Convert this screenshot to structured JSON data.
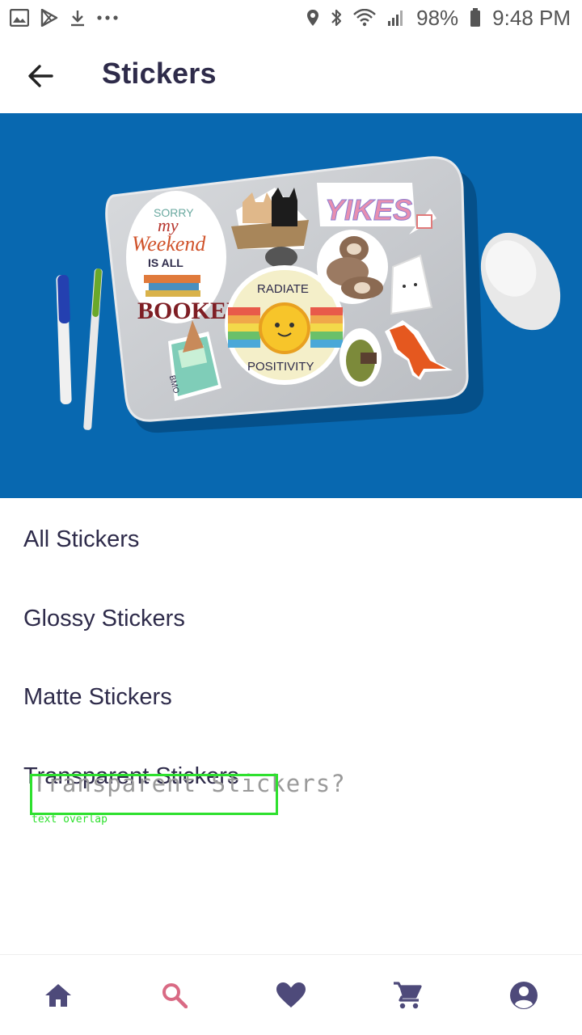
{
  "status_bar": {
    "battery": "98%",
    "time": "9:48 PM",
    "left_icons": [
      "gallery-icon",
      "play-store-icon",
      "download-icon",
      "more-dots-icon"
    ],
    "right_icons": [
      "location-icon",
      "bluetooth-icon",
      "wifi-icon",
      "signal-icon",
      "battery-icon"
    ]
  },
  "app_bar": {
    "title": "Stickers",
    "back_icon": "arrow-back-icon"
  },
  "hero": {
    "sticker_texts": [
      "SORRY",
      "my",
      "Weekend",
      "IS ALL",
      "BOOKED",
      "YIKES",
      "RADIATE",
      "POSITIVITY",
      "BMO"
    ]
  },
  "menu": {
    "items": [
      "All Stickers",
      "Glossy Stickers",
      "Matte Stickers",
      "Transparent Stickers"
    ]
  },
  "overlay": {
    "text": "Transparent Stickers?",
    "label": "text overlap",
    "color": "#2ee02e"
  },
  "bottom_nav": {
    "items": [
      {
        "icon": "home-icon",
        "active": false
      },
      {
        "icon": "search-icon",
        "active": true
      },
      {
        "icon": "heart-icon",
        "active": false
      },
      {
        "icon": "cart-icon",
        "active": false
      },
      {
        "icon": "account-icon",
        "active": false
      }
    ],
    "active_color": "#d96a84",
    "inactive_color": "#4e4a7a"
  },
  "colors": {
    "hero_background": "#0868b0",
    "text_primary": "#2e2b4a"
  }
}
